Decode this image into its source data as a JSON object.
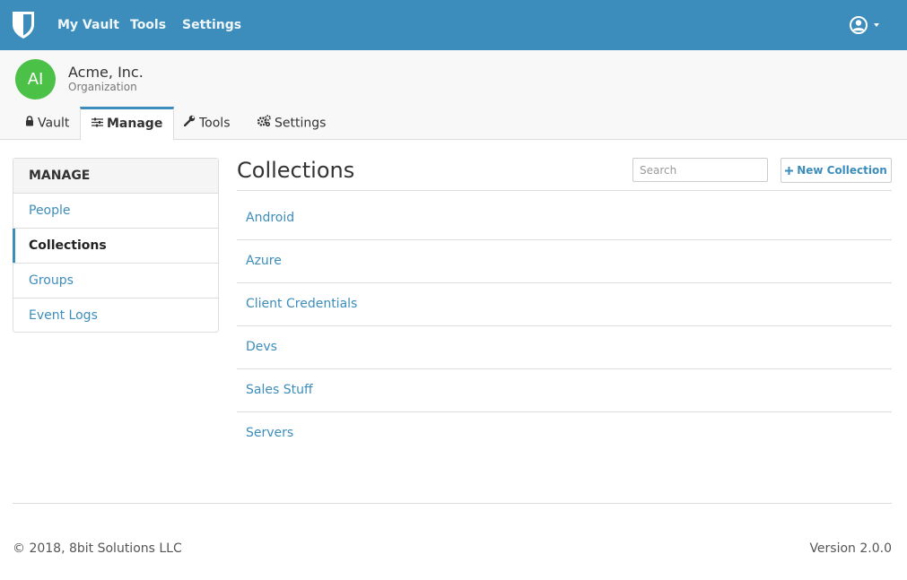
{
  "navbar": {
    "logo_icon": "shield-icon",
    "links": [
      "My Vault",
      "Tools",
      "Settings"
    ],
    "account_icon": "user-circle-icon",
    "bg_color": "#3c8dbc"
  },
  "org": {
    "avatar_initials": "AI",
    "avatar_color": "#4cc147",
    "name": "Acme, Inc.",
    "subtitle": "Organization"
  },
  "tabs": [
    {
      "label": "Vault",
      "icon": "lock-icon"
    },
    {
      "label": "Manage",
      "icon": "sliders-icon",
      "active": true
    },
    {
      "label": "Tools",
      "icon": "wrench-icon"
    },
    {
      "label": "Settings",
      "icon": "cogs-icon"
    }
  ],
  "sidebar": {
    "heading": "MANAGE",
    "items": [
      {
        "label": "People"
      },
      {
        "label": "Collections",
        "active": true
      },
      {
        "label": "Groups"
      },
      {
        "label": "Event Logs"
      }
    ]
  },
  "main": {
    "title": "Collections",
    "search_placeholder": "Search",
    "new_button_label": "New Collection",
    "collections": [
      "Android",
      "Azure",
      "Client Credentials",
      "Devs",
      "Sales Stuff",
      "Servers"
    ]
  },
  "footer": {
    "copyright": "© 2018, 8bit Solutions LLC",
    "version": "Version 2.0.0"
  }
}
